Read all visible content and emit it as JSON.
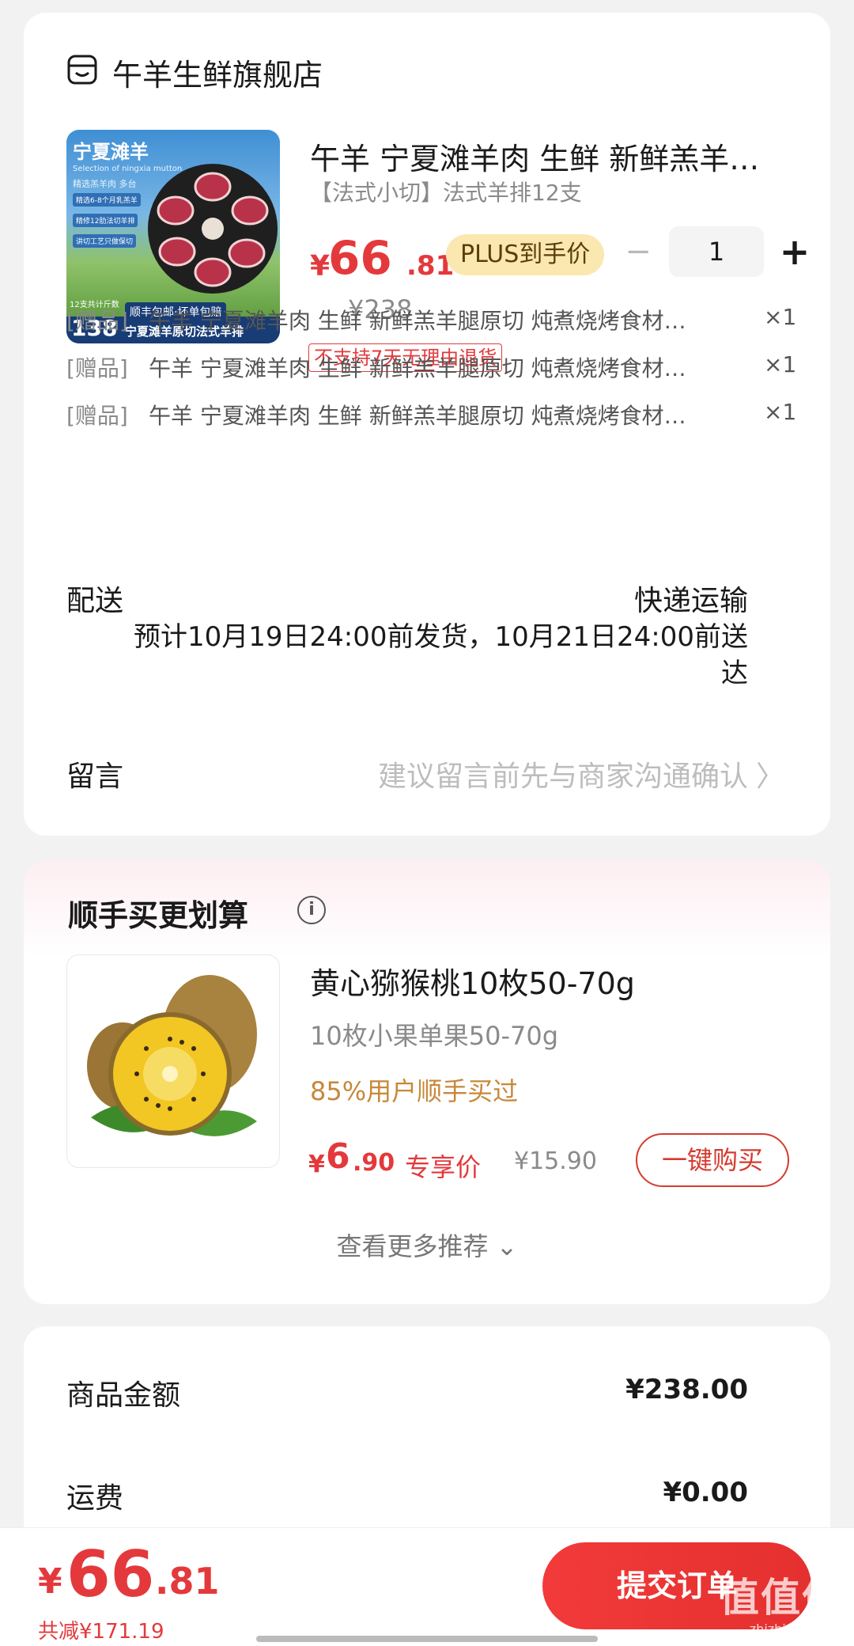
{
  "store": {
    "name": "午羊生鲜旗舰店"
  },
  "product": {
    "title": "午羊 宁夏滩羊肉 生鲜 新鲜羔羊…",
    "spec": "【法式小切】法式羊排12支",
    "price_currency": "¥",
    "price_integer": "66",
    "price_decimal": ".81",
    "plus_badge": "PLUS到手价",
    "quantity": "1",
    "original_price": "¥238",
    "no_return_tag": "不支持7天无理由退货",
    "image_texts": {
      "brand": "宁夏滩羊",
      "subtitle": "Selection of ningxia mutton",
      "line1": "精选羔羊肉 多台",
      "tag1": "精选6-8个月乳羔羊",
      "tag2": "精修12肋法切羊排",
      "tag3": "讲切工艺只做保切",
      "bottom_strip": "顺丰包邮·坏单包赔",
      "count_label": "12支共计斤数",
      "count": "138",
      "product_name": "宁夏滩羊原切法式羊排"
    }
  },
  "gifts": [
    {
      "tag": "[赠品]",
      "name": "午羊 宁夏滩羊肉 生鲜 新鲜羔羊腿原切 炖煮烧烤食材…",
      "qty": "×1"
    },
    {
      "tag": "[赠品]",
      "name": "午羊 宁夏滩羊肉 生鲜 新鲜羔羊腿原切 炖煮烧烤食材…",
      "qty": "×1"
    },
    {
      "tag": "[赠品]",
      "name": "午羊 宁夏滩羊肉 生鲜 新鲜羔羊腿原切 炖煮烧烤食材…",
      "qty": "×1"
    }
  ],
  "delivery": {
    "label": "配送",
    "method": "快递运输",
    "time": "预计10月19日24:00前发货，10月21日24:00前送达"
  },
  "note": {
    "label": "留言",
    "placeholder": "建议留言前先与商家沟通确认",
    "arrow": "〉"
  },
  "recommend": {
    "title": "顺手买更划算",
    "info_symbol": "i",
    "item": {
      "name": "黄心猕猴桃10枚50-70g",
      "spec": "10枚小果单果50-70g",
      "social_proof": "85%用户顺手买过",
      "price_currency": "¥",
      "price_integer": "6",
      "price_decimal": ".90",
      "exclusive_label": "专享价",
      "original_price": "¥15.90",
      "buy_label": "一键购买"
    },
    "more_label": "查看更多推荐 ⌄"
  },
  "summary": {
    "rows": [
      {
        "label": "商品金额",
        "value": "¥238.00"
      },
      {
        "label": "运费",
        "value": "¥0.00"
      }
    ]
  },
  "bottom": {
    "total_currency": "¥",
    "total_integer": "66",
    "total_decimal": ".81",
    "saving": "共减¥171.19",
    "submit_label": "提交订单",
    "watermark": "值值值",
    "watermark_sub": "zhizhizhi.com"
  },
  "colors": {
    "accent_red": "#e4393c",
    "plus_badge_bg": "#fbe7b0",
    "social_proof": "#c7883a"
  }
}
